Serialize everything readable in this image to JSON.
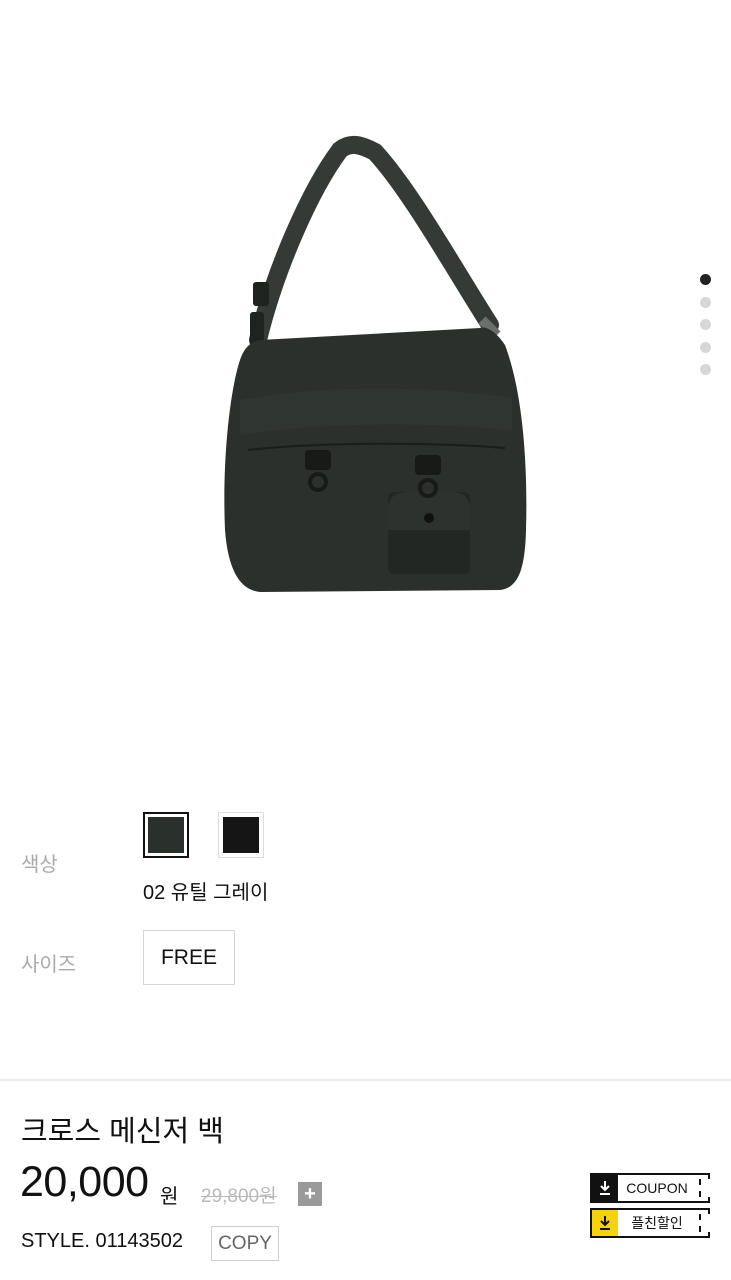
{
  "gallery": {
    "slide_count": 5,
    "active_slide": 1,
    "image_alt": "크로스 메신저 백"
  },
  "options": {
    "color_label": "색상",
    "size_label": "사이즈",
    "colors": [
      {
        "name": "02 유틸 그레이",
        "hex": "#2a302c",
        "selected": true
      },
      {
        "hex": "#151515",
        "selected": false
      }
    ],
    "selected_color_name": "02 유틸 그레이",
    "sizes": [
      "FREE"
    ]
  },
  "product": {
    "title": "크로스 메신저 백",
    "price": "20,000",
    "price_unit": "원",
    "original_price": "29,800원",
    "plus_label": "+",
    "style_text": "STYLE. 01143502",
    "copy_label": "COPY"
  },
  "tickets": {
    "coupon_label": "COUPON",
    "coupon_color": "#111111",
    "friend_label": "플친할인",
    "friend_color": "#f5d20a"
  }
}
